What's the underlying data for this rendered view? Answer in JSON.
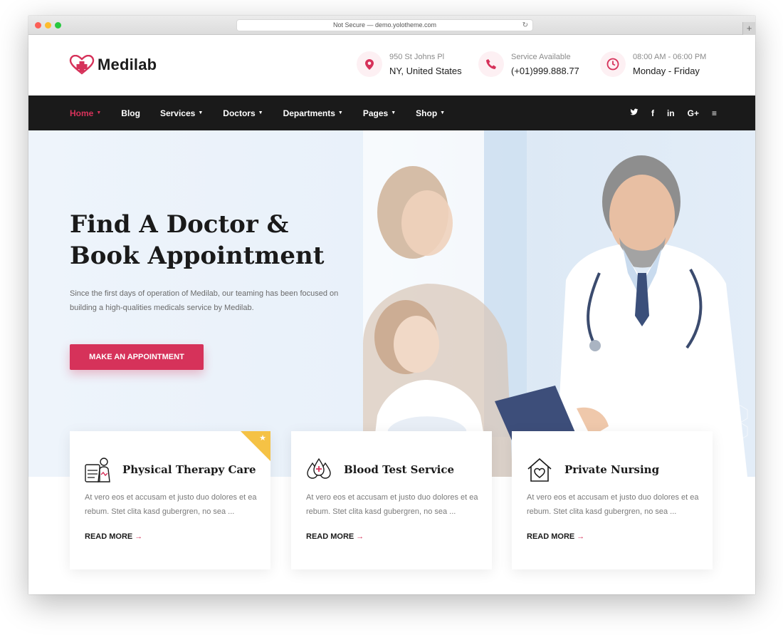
{
  "browser": {
    "url_text": "Not Secure — demo.yolotheme.com",
    "new_tab_label": "+"
  },
  "logo": {
    "text": "Medilab"
  },
  "header_info": [
    {
      "icon": "location-pin-icon",
      "label": "950 St Johns Pl",
      "value": "NY, United States"
    },
    {
      "icon": "phone-icon",
      "label": "Service Available",
      "value": "(+01)999.888.77"
    },
    {
      "icon": "clock-icon",
      "label": "08:00 AM - 06:00 PM",
      "value": "Monday - Friday"
    }
  ],
  "nav": {
    "items": [
      {
        "label": "Home",
        "dropdown": true,
        "active": true
      },
      {
        "label": "Blog",
        "dropdown": false
      },
      {
        "label": "Services",
        "dropdown": true
      },
      {
        "label": "Doctors",
        "dropdown": true
      },
      {
        "label": "Departments",
        "dropdown": true
      },
      {
        "label": "Pages",
        "dropdown": true
      },
      {
        "label": "Shop",
        "dropdown": true
      }
    ],
    "social": [
      "twitter-icon",
      "facebook-icon",
      "linkedin-icon",
      "google-plus-icon",
      "menu-icon"
    ],
    "social_glyphs": [
      "🐦",
      "f",
      "in",
      "G+",
      "≡"
    ]
  },
  "hero": {
    "title_line1": "Find A Doctor &",
    "title_line2": "Book Appointment",
    "subtitle": "Since the first days of operation of Medilab, our teaming has been focused on building a high-qualities medicals service by Medilab.",
    "cta_label": "MAKE AN APPOINTMENT"
  },
  "cards": [
    {
      "icon": "therapy-icon",
      "title": "Physical Therapy Care",
      "text": "At vero eos et accusam et justo duo dolores et ea rebum. Stet clita kasd gubergren, no sea ...",
      "link": "READ MORE",
      "featured": true
    },
    {
      "icon": "blood-drops-icon",
      "title": "Blood Test Service",
      "text": "At vero eos et accusam et justo duo dolores et ea rebum. Stet clita kasd gubergren, no sea ...",
      "link": "READ MORE",
      "featured": false
    },
    {
      "icon": "home-heart-icon",
      "title": "Private Nursing",
      "text": "At vero eos et accusam et justo duo dolores et ea rebum. Stet clita kasd gubergren, no sea ...",
      "link": "READ MORE",
      "featured": false
    }
  ],
  "colors": {
    "accent": "#d6325a",
    "nav_bg": "#1a1a1a",
    "ribbon": "#f5c245"
  }
}
